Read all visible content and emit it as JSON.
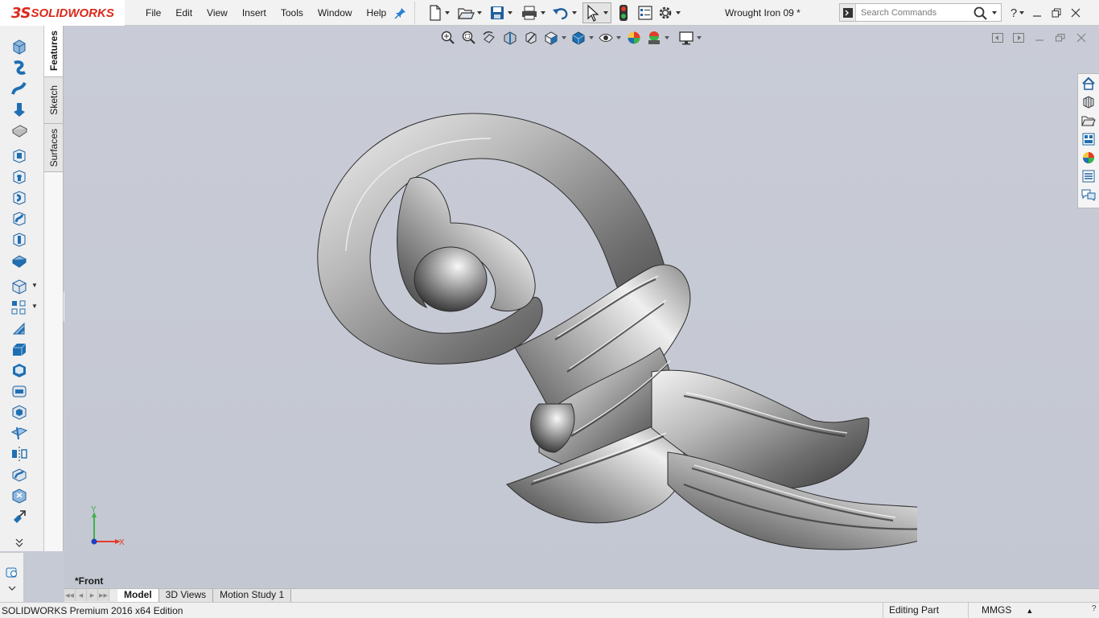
{
  "app": {
    "logo_ds": "3S",
    "logo_text": "SOLIDWORKS",
    "document_title": "Wrought Iron 09 *"
  },
  "menu": [
    "File",
    "Edit",
    "View",
    "Insert",
    "Tools",
    "Window",
    "Help"
  ],
  "search": {
    "placeholder": "Search Commands"
  },
  "left_tabs": {
    "features": "Features",
    "sketch": "Sketch",
    "surfaces": "Surfaces"
  },
  "viewport": {
    "view_name": "*Front",
    "triad_y": "Y",
    "triad_x": "X"
  },
  "bottom_tabs": [
    "Model",
    "3D Views",
    "Motion Study 1"
  ],
  "status": {
    "product": "SOLIDWORKS Premium 2016 x64 Edition",
    "mode": "Editing Part",
    "units": "MMGS"
  },
  "colors": {
    "brand_red": "#da291c",
    "viewport_bg": "#c6cad5",
    "icon_blue": "#1f6fb2"
  },
  "icons": {
    "toolbar": [
      "new-document-icon",
      "open-icon",
      "save-icon",
      "print-icon",
      "undo-icon",
      "select-icon",
      "rebuild-icon",
      "file-properties-icon",
      "options-icon"
    ],
    "headsup": [
      "zoom-to-fit-icon",
      "zoom-to-area-icon",
      "previous-view-icon",
      "section-view-icon",
      "view-orientation-icon",
      "display-style-icon",
      "hide-show-items-icon",
      "edit-appearance-icon",
      "apply-scene-icon",
      "view-settings-icon"
    ],
    "taskpane": [
      "solidworks-resources-icon",
      "design-library-icon",
      "file-explorer-icon",
      "view-palette-icon",
      "appearances-icon",
      "custom-properties-icon",
      "forum-icon"
    ]
  }
}
